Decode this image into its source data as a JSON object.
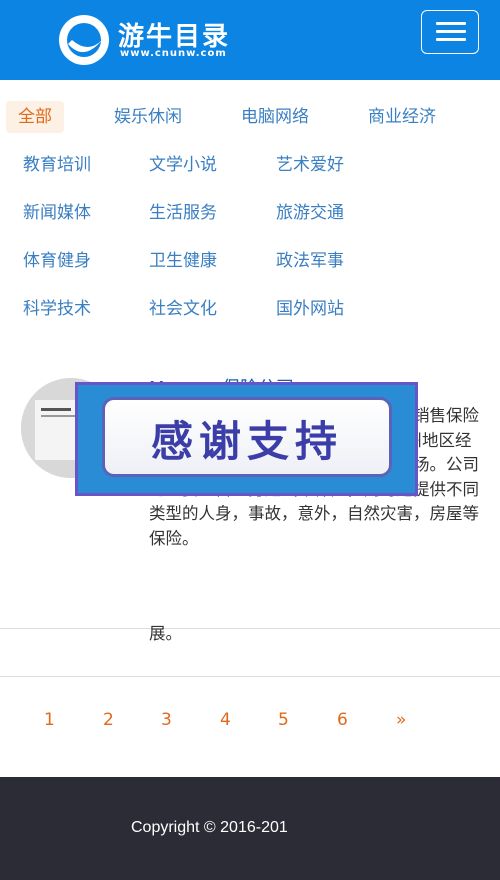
{
  "header": {
    "logo_title": "游牛目录",
    "logo_url": "www.cnunw.com",
    "menu_icon": "hamburger-menu-icon",
    "brand_color": "#0c84e4"
  },
  "categories": [
    {
      "label": "全部",
      "active": true
    },
    {
      "label": "娱乐休闲"
    },
    {
      "label": "电脑网络"
    },
    {
      "label": "商业经济"
    },
    {
      "label": "教育培训"
    },
    {
      "label": "文学小说"
    },
    {
      "label": "艺术爱好"
    },
    {
      "label": "新闻媒体"
    },
    {
      "label": "生活服务"
    },
    {
      "label": "旅游交通"
    },
    {
      "label": "体育健身"
    },
    {
      "label": "卫生健康"
    },
    {
      "label": "政法军事"
    },
    {
      "label": "科学技术"
    },
    {
      "label": "社会文化"
    },
    {
      "label": "国外网站"
    }
  ],
  "article": {
    "title": "Mercury保险公司",
    "body": "财产保险公司，公司通过独立代理商销售保险政策，直到1990年公司还只是在加州地区经营，后来逐步扩张到一些全国性的市场。公司的主要经营业务是汽车保险，同时还提供不同类型的人身，事故，意外，自然灾害，房屋等保险。",
    "tail": "展。"
  },
  "overlay": {
    "text": "感谢支持"
  },
  "pagination": [
    "1",
    "2",
    "3",
    "4",
    "5",
    "6",
    "»"
  ],
  "footer": {
    "copyright": "Copyright © 2016-201"
  }
}
